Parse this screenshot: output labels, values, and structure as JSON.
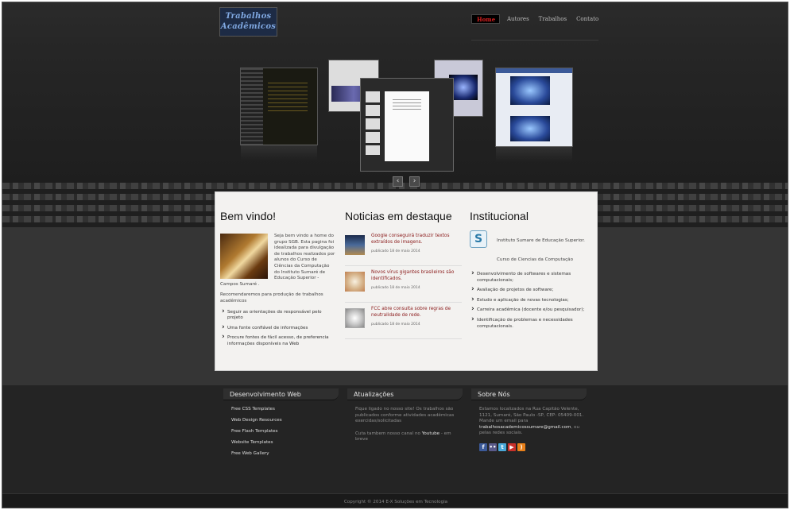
{
  "logo": {
    "line1": "Trabalhos",
    "line2": "Acadêmicos"
  },
  "nav": {
    "items": [
      {
        "label": "Home",
        "active": true
      },
      {
        "label": "Autores",
        "active": false
      },
      {
        "label": "Trabalhos",
        "active": false
      },
      {
        "label": "Contato",
        "active": false
      }
    ]
  },
  "gallery": {
    "prev_icon": "chevron-left-icon",
    "next_icon": "chevron-right-icon"
  },
  "welcome": {
    "title": "Bem vindo!",
    "text": "Seja bem vindo a home do grupo SGB. Esta pagina foi idealizada para divulgação de trabalhos realizados por alunos do Curso de Ciências da Computação do Instituto Sumaré de Educação Superior - Campos Sumaré .",
    "recommend": "Recomendaremos para produção de trabalhos acadêmicos",
    "bullets": [
      "Seguir as orientações do responsável pelo projeto",
      "Uma fonte confiável de informações",
      "Procure fontes de fácil acesso, de preferencia informações disponíveis na Web"
    ]
  },
  "news": {
    "title": "Noticias em destaque",
    "items": [
      {
        "title": "Google conseguirá traduzir textos extraídos de imagens.",
        "date": "publicado 18 de maio 2014"
      },
      {
        "title": "Novos vírus gigantes brasileiros são identificados.",
        "date": "publicado 18 de maio 2014"
      },
      {
        "title": "FCC abre consulta sobre regras de neutralidade de rede.",
        "date": "publicado 18 de maio 2014"
      }
    ]
  },
  "institucional": {
    "title": "Institucional",
    "logo_letter": "S",
    "name": "Instituto Sumare de Educação Superior.",
    "course": "Curso de Ciencias da Computação",
    "items": [
      "Desenvolvimento de softwares e sistemas computacionais;",
      "Avaliação de projetos de software;",
      "Estudo e aplicação de novas tecnologias;",
      "Carreira acadêmica (docente e/ou pesquisador);",
      "Identificação de problemas e necessidades computacionais."
    ]
  },
  "footer": {
    "dev": {
      "title": "Desenvolvimento Web",
      "links": [
        "Free CSS Templates",
        "Web Design Resources",
        "Free Flash Templates",
        "Website Templates",
        "Free Web Gallery"
      ]
    },
    "updates": {
      "title": "Atualizações",
      "text1": "Fique ligado no nosso site! Os trabalhos são publicados conforme atividades acadêmicas exercidas/solicitadas",
      "text2_prefix": "Cuta tambem nosso canal no ",
      "text2_link": "Youtube",
      "text2_suffix": " - em breve"
    },
    "about": {
      "title": "Sobre Nós",
      "text": "Estamos localizados na Rua Capitão Velente, 1121, Sumaré, São Paulo -SP, CEP: 05409-001. Mande um email para",
      "email": "trabalhosacademicossumare@gmail.com",
      "text_end": ", ou pelas redes sociais.",
      "social": [
        {
          "icon": "facebook-icon",
          "glyph": "f",
          "color": "#3b5998"
        },
        {
          "icon": "flickr-icon",
          "glyph": "••",
          "color": "#5a5a8a"
        },
        {
          "icon": "twitter-icon",
          "glyph": "t",
          "color": "#4aa8d8"
        },
        {
          "icon": "youtube-icon",
          "glyph": "▶",
          "color": "#c8302a"
        },
        {
          "icon": "rss-icon",
          "glyph": ")",
          "color": "#e8801a"
        }
      ]
    },
    "copyright": "Copyright © 2014 E-X Soluções em Tecnologia"
  }
}
